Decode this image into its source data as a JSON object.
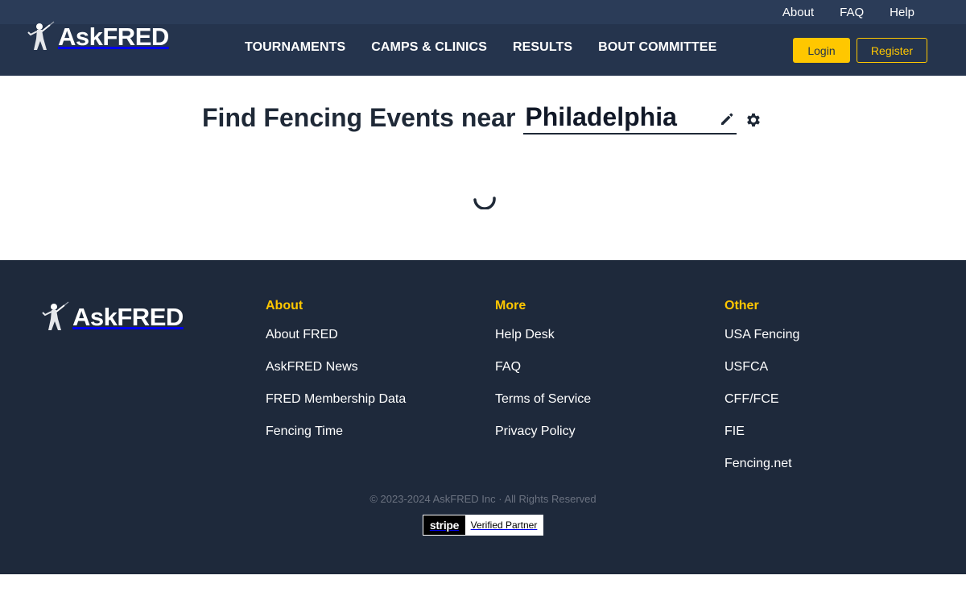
{
  "header": {
    "logo_text": "AskFRED",
    "util_nav": [
      "About",
      "FAQ",
      "Help"
    ],
    "main_nav": [
      "TOURNAMENTS",
      "CAMPS & CLINICS",
      "RESULTS",
      "BOUT COMMITTEE"
    ],
    "login_label": "Login",
    "register_label": "Register"
  },
  "finder": {
    "title": "Find Fencing Events near",
    "location_value": "Philadelphia"
  },
  "footer": {
    "logo_text": "AskFRED",
    "columns": [
      {
        "heading": "About",
        "links": [
          "About FRED",
          "AskFRED News",
          "FRED Membership Data",
          "Fencing Time"
        ]
      },
      {
        "heading": "More",
        "links": [
          "Help Desk",
          "FAQ",
          "Terms of Service",
          "Privacy Policy"
        ]
      },
      {
        "heading": "Other",
        "links": [
          "USA Fencing",
          "USFCA",
          "CFF/FCE",
          "FIE",
          "Fencing.net"
        ]
      }
    ],
    "copyright": "© 2023-2024 AskFRED Inc · All Rights Reserved",
    "stripe_badge": {
      "brand": "stripe",
      "label": "Verified Partner"
    }
  },
  "colors": {
    "header_bg": "#25344d",
    "footer_bg": "#1e293b",
    "accent": "#ffc700"
  },
  "icons": [
    "fencer-logo-icon",
    "pencil-edit-icon",
    "gear-icon",
    "loading-spinner-icon"
  ]
}
